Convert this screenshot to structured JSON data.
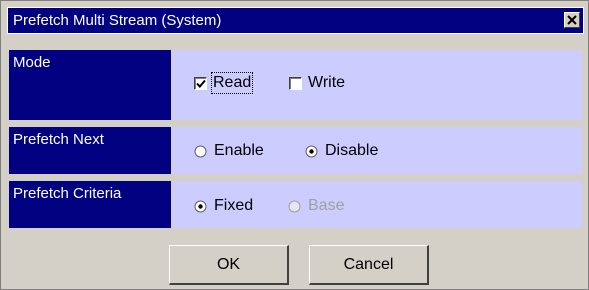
{
  "window": {
    "title": "Prefetch Multi Stream (System)"
  },
  "rows": {
    "mode": {
      "label": "Mode",
      "options": [
        {
          "label": "Read",
          "checked": true
        },
        {
          "label": "Write",
          "checked": false
        }
      ]
    },
    "prefetch_next": {
      "label": "Prefetch Next",
      "options": [
        {
          "label": "Enable",
          "selected": false
        },
        {
          "label": "Disable",
          "selected": true
        }
      ]
    },
    "prefetch_criteria": {
      "label": "Prefetch Criteria",
      "options": [
        {
          "label": "Fixed",
          "selected": true,
          "enabled": true
        },
        {
          "label": "Base",
          "selected": false,
          "enabled": false
        }
      ]
    }
  },
  "buttons": {
    "ok": "OK",
    "cancel": "Cancel"
  },
  "colors": {
    "title_bg": "#000080",
    "label_bg": "#000080",
    "value_bg": "#ccccff",
    "dialog_bg": "#d4d0c8"
  }
}
